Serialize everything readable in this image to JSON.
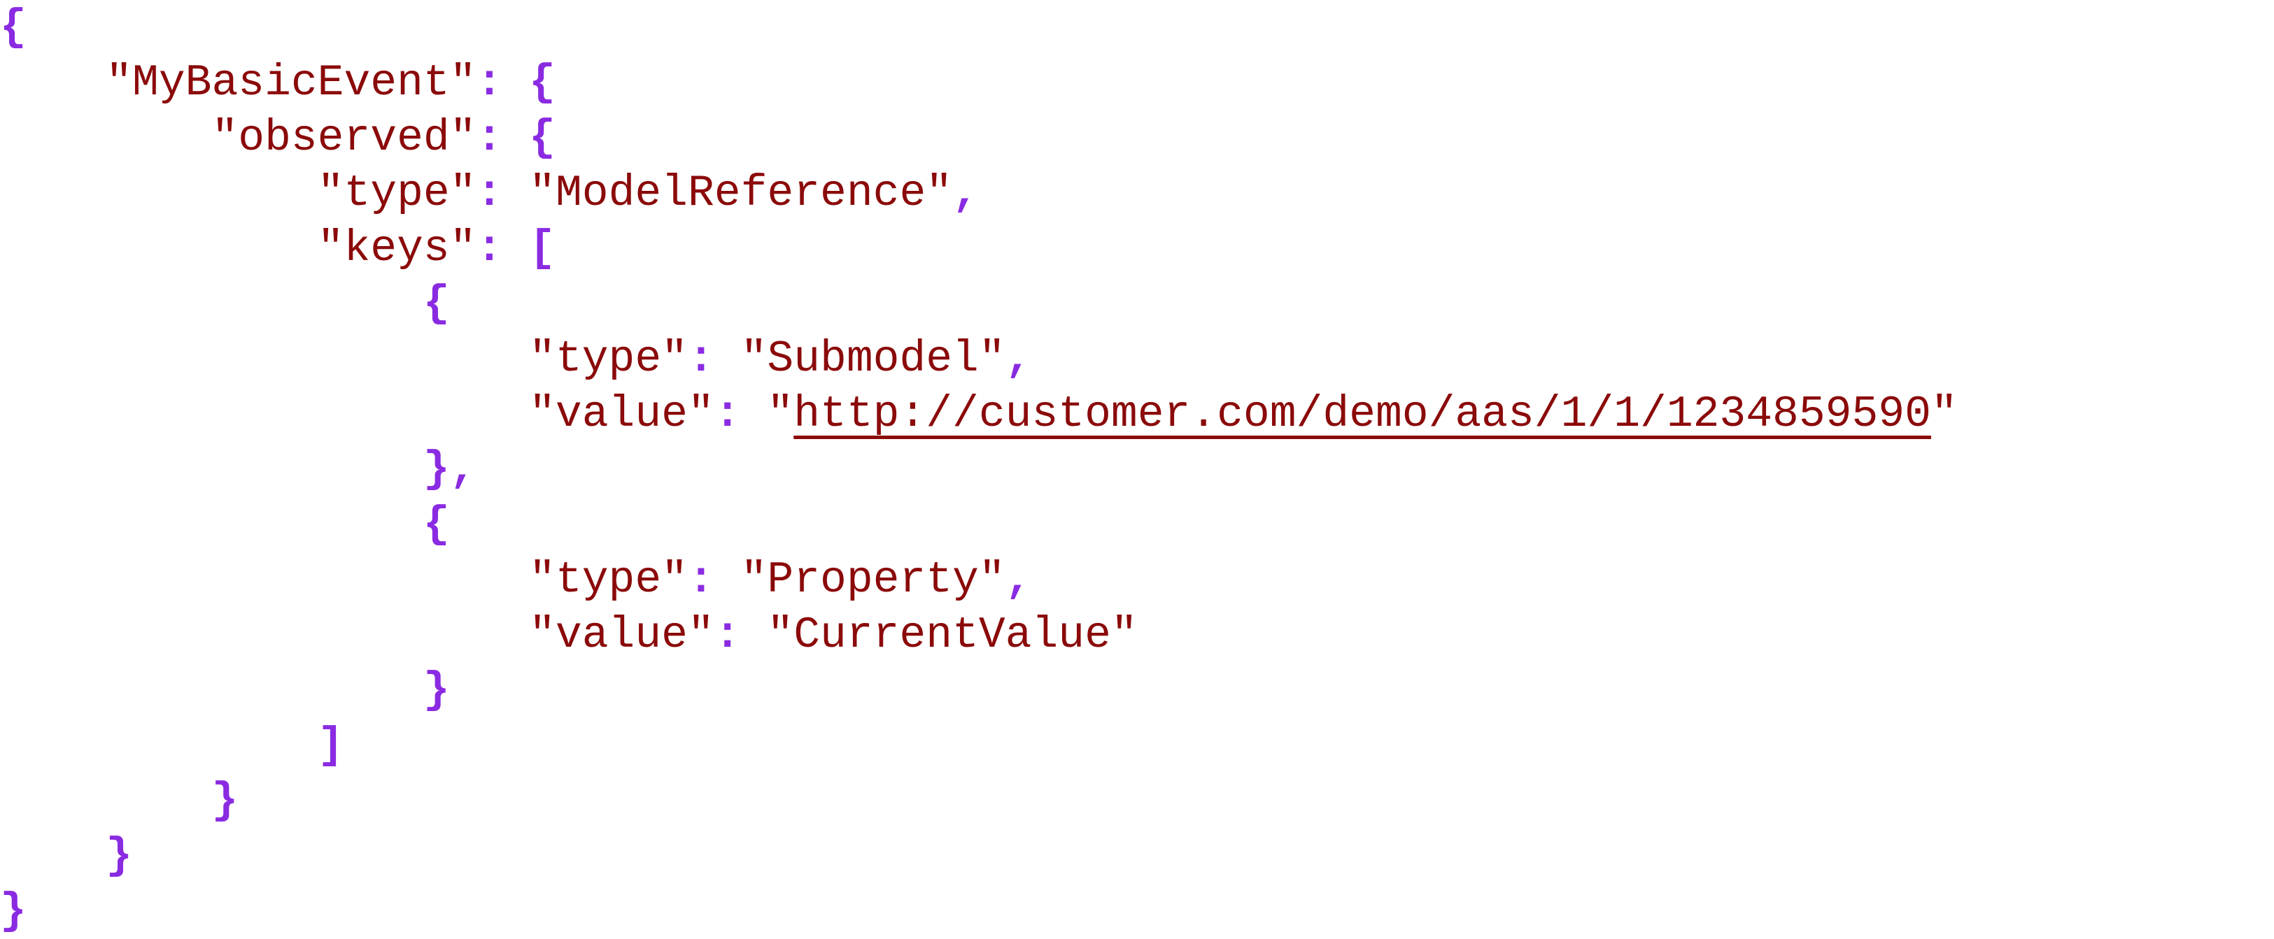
{
  "colors": {
    "string": "#8b0a0a",
    "punctuation": "#8a2be2",
    "background": "#ffffff"
  },
  "json": {
    "open_brace": "{",
    "close_brace": "}",
    "open_bracket": "[",
    "close_bracket": "]",
    "colon": ": ",
    "comma": ",",
    "root_key": "\"MyBasicEvent\"",
    "observed_key": "\"observed\"",
    "type_key": "\"type\"",
    "keys_key": "\"keys\"",
    "value_key": "\"value\"",
    "observed_type": "\"ModelReference\"",
    "key1_type": "\"Submodel\"",
    "key1_value_quote": "\"",
    "key1_value_url": "http://customer.com/demo/aas/1/1/1234859590",
    "key2_type": "\"Property\"",
    "key2_value": "\"CurrentValue\""
  }
}
